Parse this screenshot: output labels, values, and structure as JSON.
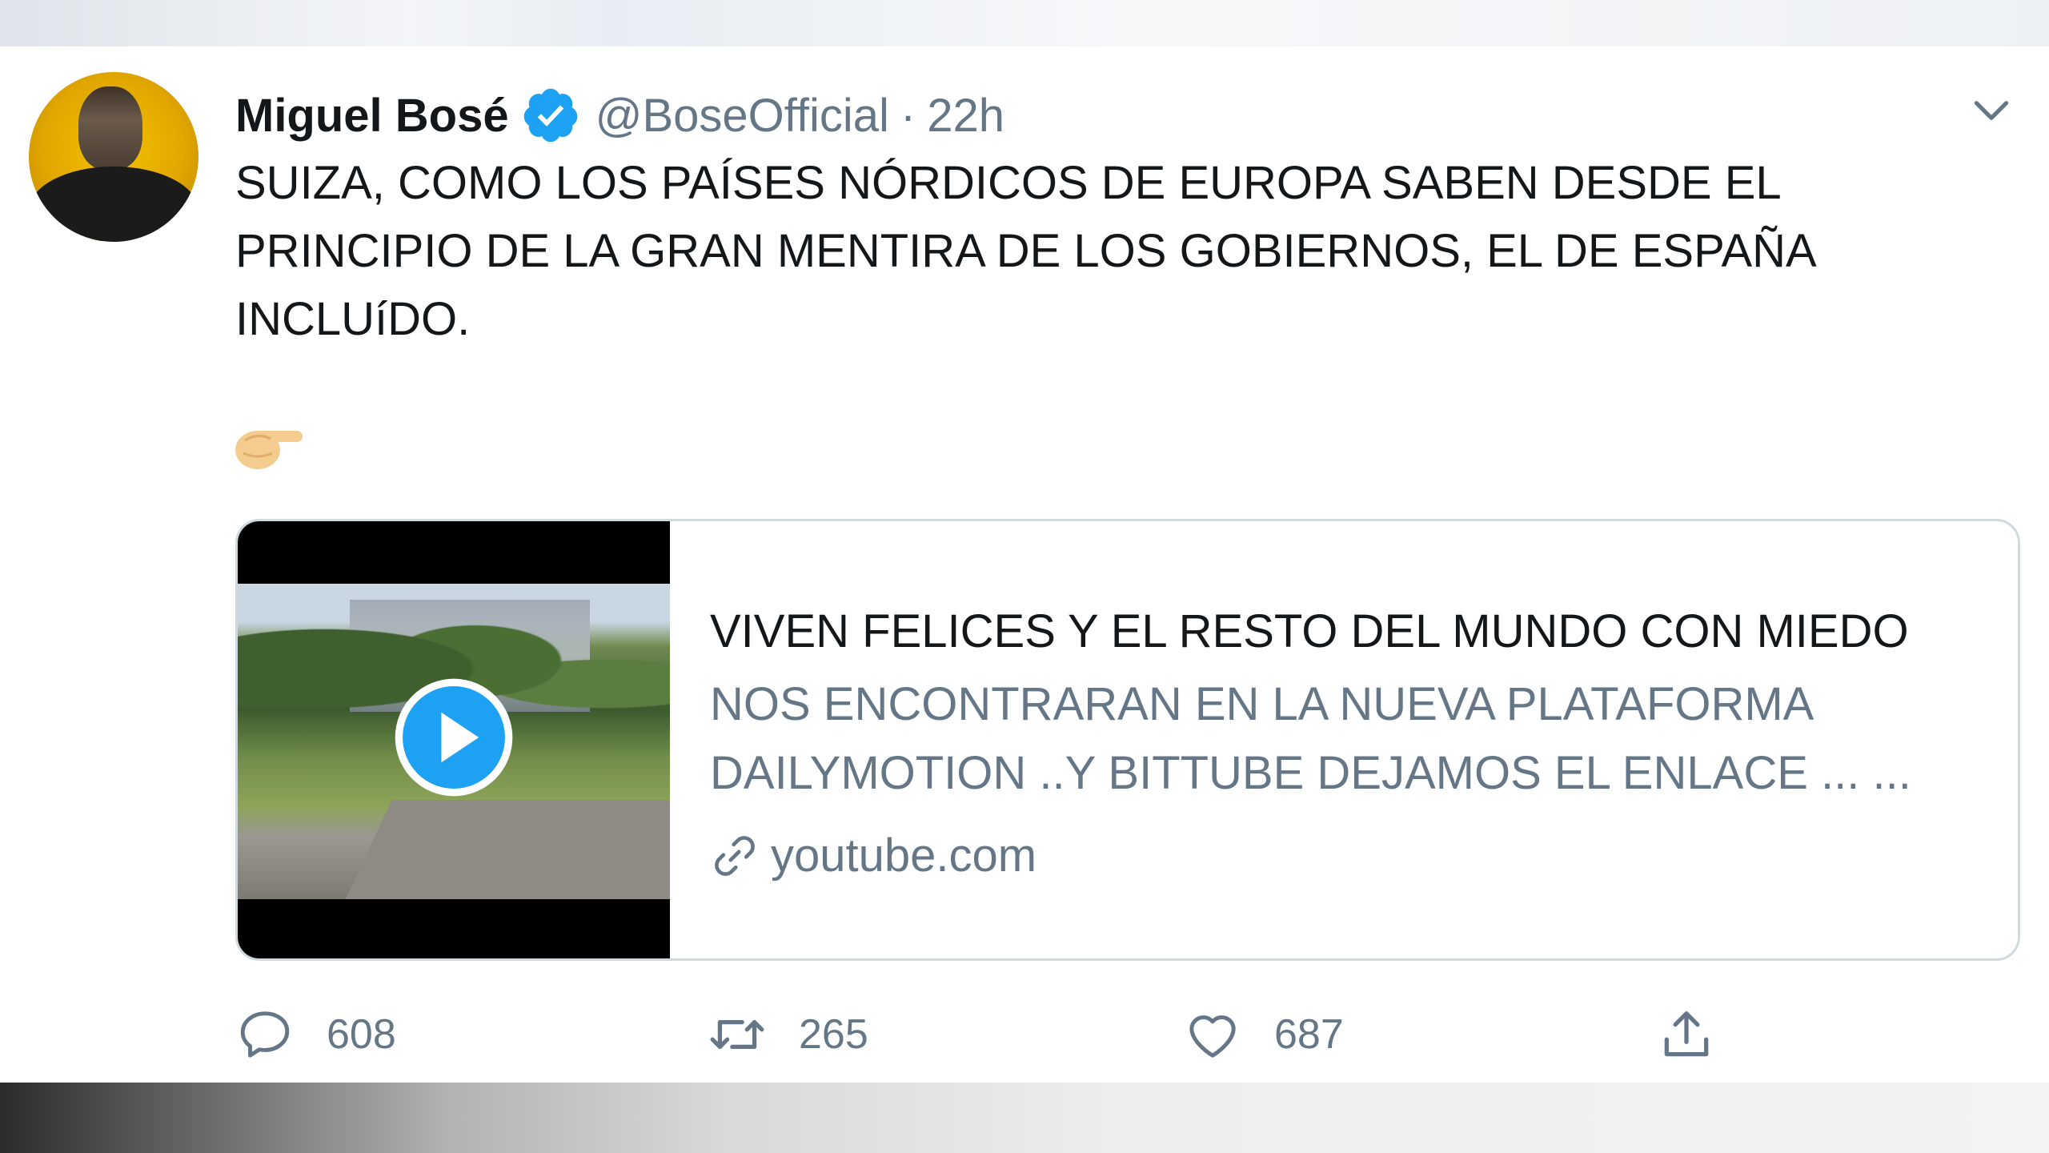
{
  "tweet": {
    "author_name": "Miguel Bosé",
    "handle": "@BoseOfficial",
    "separator": "·",
    "time": "22h",
    "text_lines": [
      "SUIZA, COMO LOS PAÍSES NÓRDICOS DE EUROPA SABEN DESDE EL",
      "PRINCIPIO DE LA GRAN MENTIRA DE LOS GOBIERNOS, EL DE ESPAÑA",
      "INCLUíDO."
    ],
    "emoji": "backhand-index-pointing-right"
  },
  "card": {
    "title": "VIVEN FELICES Y EL RESTO DEL MUNDO CON MIEDO",
    "description_lines": [
      "NOS ENCONTRARAN EN LA NUEVA PLATAFORMA",
      "DAILYMOTION ..Y BITTUBE DEJAMOS EL ENLACE ... ..."
    ],
    "domain": "youtube.com"
  },
  "actions": {
    "replies": "608",
    "retweets": "265",
    "likes": "687"
  },
  "colors": {
    "verified": "#1da1f2",
    "text": "#14171a",
    "muted": "#657786",
    "border": "#cfd9de"
  },
  "icons": {
    "verified": "verified-badge-icon",
    "caret": "chevron-down-icon",
    "play": "play-icon",
    "link": "link-icon",
    "reply": "reply-icon",
    "retweet": "retweet-icon",
    "like": "heart-icon",
    "share": "share-icon"
  }
}
